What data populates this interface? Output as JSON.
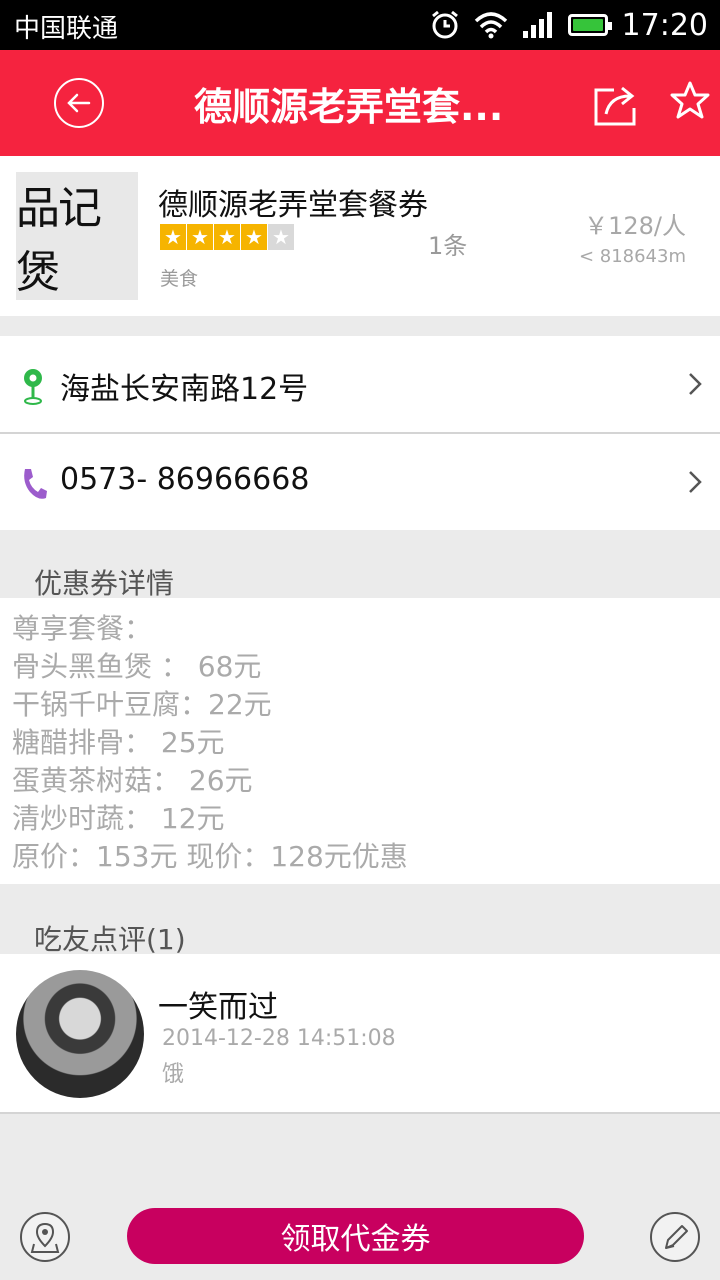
{
  "status_bar": {
    "carrier": "中国联通",
    "time": "17:20",
    "battery_level": 1.0
  },
  "header": {
    "title": "德顺源老弄堂套...",
    "back_icon": "back-arrow-icon",
    "share_icon": "share-icon",
    "favorite_icon": "star-icon"
  },
  "shop": {
    "thumb_text": "品记煲",
    "name": "德顺源老弄堂套餐券",
    "rating": 4,
    "rating_max": 5,
    "reviews": "1条",
    "category": "美食",
    "price": "￥128/人",
    "distance": "< 818643m"
  },
  "address": {
    "text": "海盐长安南路12号",
    "icon": "location-pin-icon"
  },
  "phone": {
    "text": "0573- 86966668",
    "icon": "phone-icon"
  },
  "coupon_section": {
    "title": "优惠券详情",
    "lines": [
      "尊享套餐：",
      "骨头黑鱼煲 ： 68元",
      "干锅千叶豆腐：22元",
      "糖醋排骨： 25元",
      "蛋黄茶树菇： 26元",
      "清炒时蔬： 12元",
      "原价：153元 现价：128元优惠"
    ]
  },
  "review_section": {
    "title": "吃友点评(1)",
    "reviews": [
      {
        "user": "一笑而过",
        "date": "2014-12-28 14:51:08",
        "content": "饿"
      }
    ]
  },
  "bottom_bar": {
    "get_coupon_label": "领取代金券",
    "map_icon": "map-icon",
    "edit_icon": "pencil-icon"
  },
  "colors": {
    "header": "#f5233f",
    "button": "#c8005f",
    "star": "#f6b400",
    "pin": "#2fb84a",
    "phone": "#9c5ccc"
  }
}
